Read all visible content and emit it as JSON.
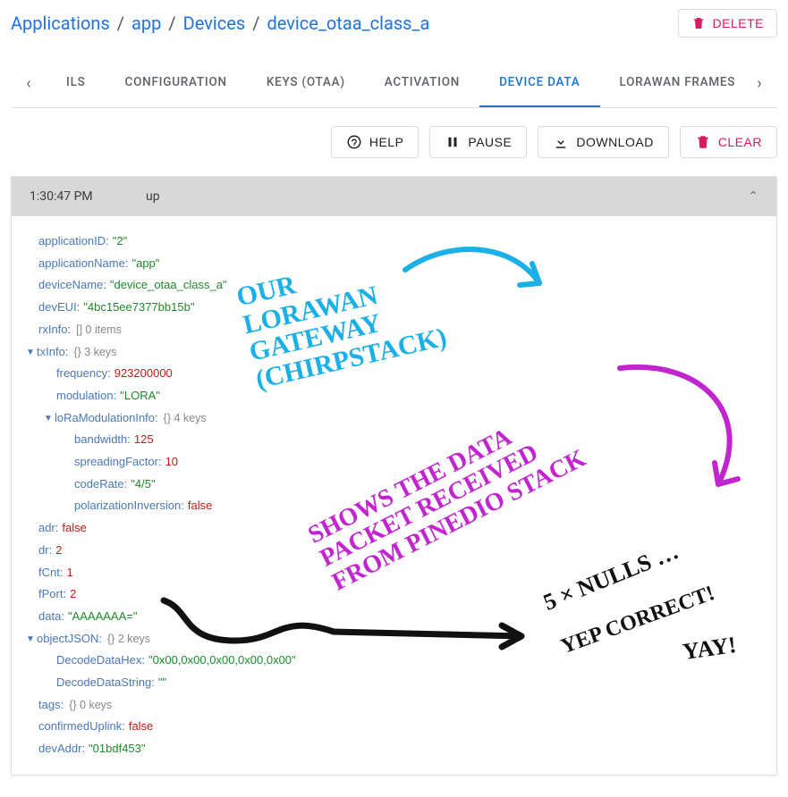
{
  "breadcrumb": {
    "items": [
      {
        "label": "Applications"
      },
      {
        "label": "app"
      },
      {
        "label": "Devices"
      },
      {
        "label": "device_otaa_class_a"
      }
    ]
  },
  "delete_label": "DELETE",
  "tabs": {
    "items": [
      {
        "label": "ILS"
      },
      {
        "label": "CONFIGURATION"
      },
      {
        "label": "KEYS (OTAA)"
      },
      {
        "label": "ACTIVATION"
      },
      {
        "label": "DEVICE DATA",
        "active": true
      },
      {
        "label": "LORAWAN FRAMES"
      }
    ]
  },
  "actions": {
    "help": "HELP",
    "pause": "PAUSE",
    "download": "DOWNLOAD",
    "clear": "CLEAR"
  },
  "event": {
    "time": "1:30:47 PM",
    "direction": "up"
  },
  "payload": {
    "applicationID": {
      "k": "applicationID",
      "v": "\"2\""
    },
    "applicationName": {
      "k": "applicationName",
      "v": "\"app\""
    },
    "deviceName": {
      "k": "deviceName",
      "v": "\"device_otaa_class_a\""
    },
    "devEUI": {
      "k": "devEUI",
      "v": "\"4bc15ee7377bb15b\""
    },
    "rxInfo": {
      "k": "rxInfo",
      "meta": "[] 0 items"
    },
    "txInfo": {
      "k": "txInfo",
      "meta": "{} 3 keys"
    },
    "frequency": {
      "k": "frequency",
      "v": "923200000"
    },
    "modulation": {
      "k": "modulation",
      "v": "\"LORA\""
    },
    "loRaModulationInfo": {
      "k": "loRaModulationInfo",
      "meta": "{} 4 keys"
    },
    "bandwidth": {
      "k": "bandwidth",
      "v": "125"
    },
    "spreadingFactor": {
      "k": "spreadingFactor",
      "v": "10"
    },
    "codeRate": {
      "k": "codeRate",
      "v": "\"4/5\""
    },
    "polarizationInversion": {
      "k": "polarizationInversion",
      "v": "false"
    },
    "adr": {
      "k": "adr",
      "v": "false"
    },
    "dr": {
      "k": "dr",
      "v": "2"
    },
    "fCnt": {
      "k": "fCnt",
      "v": "1"
    },
    "fPort": {
      "k": "fPort",
      "v": "2"
    },
    "data": {
      "k": "data",
      "v": "\"AAAAAAA=\""
    },
    "objectJSON": {
      "k": "objectJSON",
      "meta": "{} 2 keys"
    },
    "DecodeDataHex": {
      "k": "DecodeDataHex",
      "v": "\"0x00,0x00,0x00,0x00,0x00\""
    },
    "DecodeDataString": {
      "k": "DecodeDataString",
      "v": "\"\""
    },
    "tags": {
      "k": "tags",
      "meta": "{} 0 keys"
    },
    "confirmedUplink": {
      "k": "confirmedUplink",
      "v": "false"
    },
    "devAddr": {
      "k": "devAddr",
      "v": "\"01bdf453\""
    }
  },
  "annotations": {
    "cyan": "OUR\nLORAWAN\nGATEWAY\n(CHIRPSTACK)",
    "magenta": "SHOWS THE DATA\nPACKET RECEIVED\nFROM PINEDIO STACK",
    "black1": "5 × NULLS …",
    "black2": "YEP CORRECT!",
    "black3": "YAY!"
  }
}
